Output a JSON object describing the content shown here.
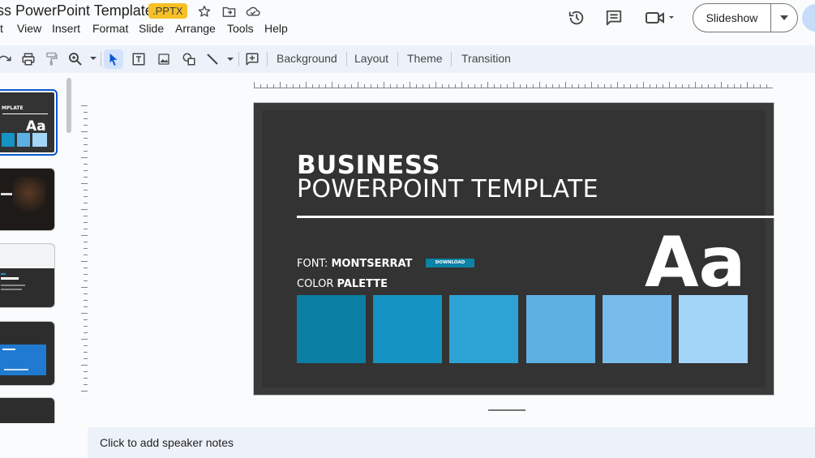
{
  "header": {
    "doc_title": "ss PowerPoint Template",
    "badge": ".PPTX",
    "icons": [
      "star-icon",
      "move-to-folder-icon",
      "cloud-saved-icon"
    ],
    "right_icons": [
      "version-history-icon",
      "comments-icon",
      "meet-camera-icon"
    ],
    "slideshow_label": "Slideshow"
  },
  "menu": [
    "t",
    "View",
    "Insert",
    "Format",
    "Slide",
    "Arrange",
    "Tools",
    "Help"
  ],
  "toolbar": {
    "background_label": "Background",
    "layout_label": "Layout",
    "theme_label": "Theme",
    "transition_label": "Transition"
  },
  "slide": {
    "title_line1": "BUSINESS",
    "title_line2": "POWERPOINT TEMPLATE",
    "font_prefix": "FONT: ",
    "font_name": "MONTSERRAT",
    "download_label": "DOWNLOAD",
    "color_prefix": "COLOR ",
    "color_word": "PALETTE",
    "aa": "Aa",
    "palette": [
      "#0b7fa3",
      "#1593c3",
      "#2da3d6",
      "#5eafe2",
      "#78bcec",
      "#a3d5f8"
    ],
    "background": "#333333"
  },
  "filmstrip": {
    "thumb1_text": "MPLATE",
    "thumb1_aa": "Aa"
  },
  "notes": {
    "placeholder": "Click to add speaker notes"
  },
  "colors": {
    "accent": "#0b57d0",
    "badge": "#f6c026"
  }
}
